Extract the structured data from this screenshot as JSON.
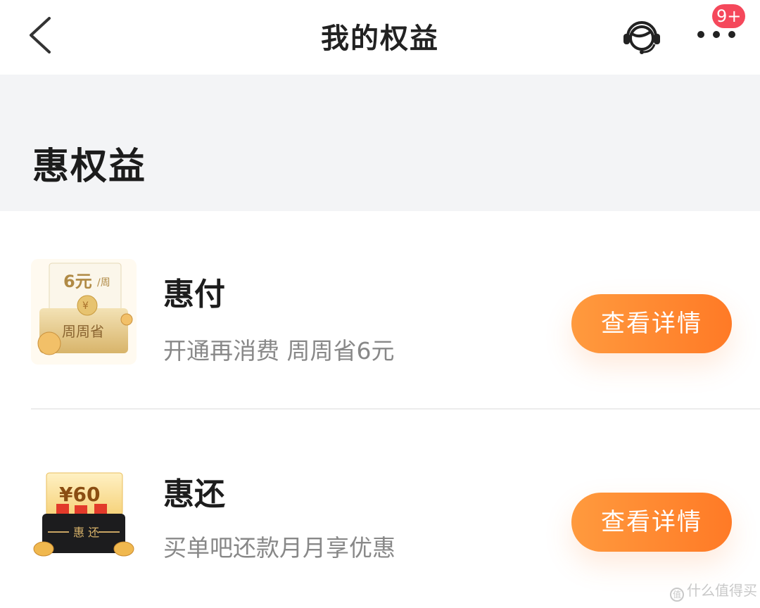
{
  "header": {
    "title": "我的权益",
    "badge": "9+",
    "back_icon": "chevron-left-icon",
    "service_icon": "customer-service-icon",
    "more_icon": "more-dots-icon"
  },
  "section": {
    "title": "惠权益"
  },
  "items": [
    {
      "name": "惠付",
      "desc": "开通再消费 周周省6元",
      "button": "查看详情",
      "thumb": {
        "price_tag": "6元/周",
        "label": "周周省"
      }
    },
    {
      "name": "惠还",
      "desc": "买单吧还款月月享优惠",
      "button": "查看详情",
      "thumb": {
        "price_tag": "¥60",
        "label": "惠 还"
      }
    }
  ],
  "watermark": "什么值得买",
  "colors": {
    "accent": "#ff8a30",
    "badge": "#f5485b",
    "section_bg": "#f3f4f6"
  }
}
